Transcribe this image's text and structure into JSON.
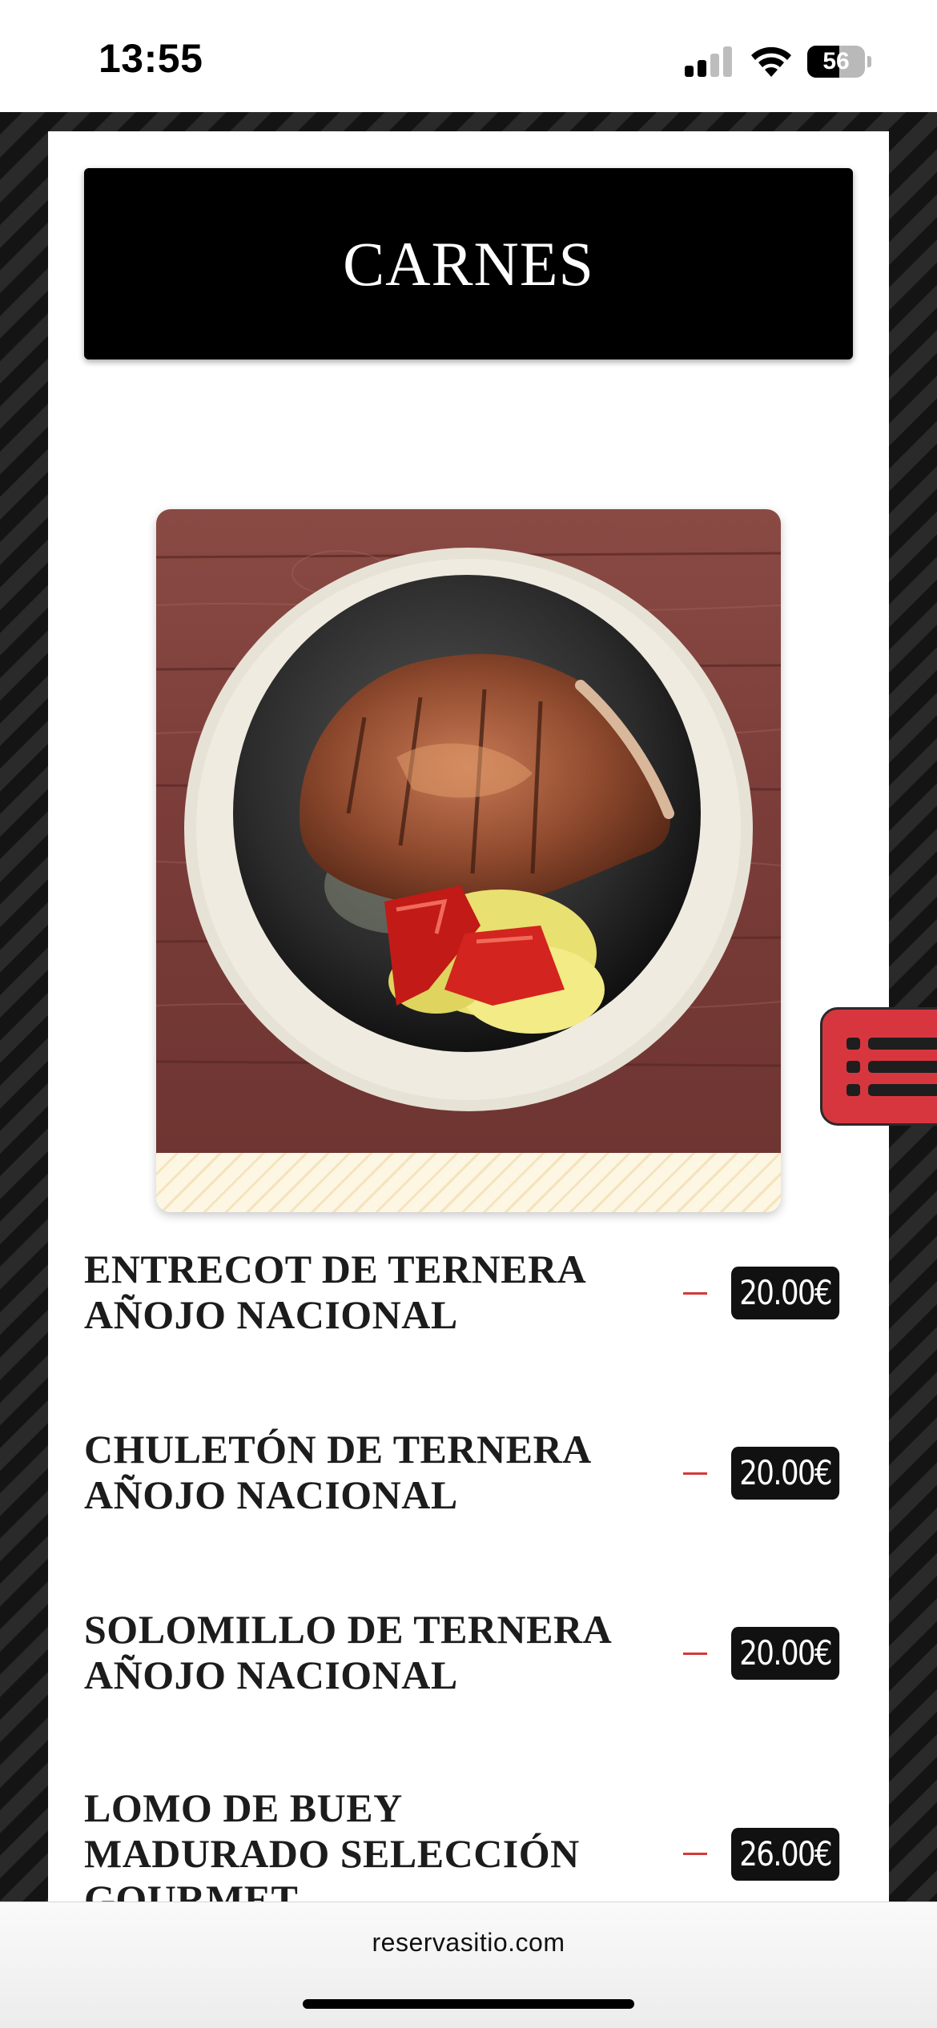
{
  "status_bar": {
    "time": "13:55",
    "battery": "56"
  },
  "section": {
    "title": "CARNES"
  },
  "photo": {
    "description_icon": "steak-photo"
  },
  "menu_items": [
    {
      "name": "ENTRECOT DE TERNERA AÑOJO NACIONAL",
      "price": "20.00€"
    },
    {
      "name": "CHULETÓN DE TERNERA AÑOJO NACIONAL",
      "price": "20.00€"
    },
    {
      "name": "SOLOMILLO DE TERNERA AÑOJO NACIONAL",
      "price": "20.00€"
    },
    {
      "name": "LOMO DE BUEY MADURADO SELECCIÓN GOURMET",
      "price": "26.00€"
    }
  ],
  "floating_button": {
    "icon": "list-icon"
  },
  "browser": {
    "url": "reservasitio.com"
  },
  "colors": {
    "accent": "#d8363f",
    "header_bg": "#000000",
    "price_bg": "#111111"
  }
}
